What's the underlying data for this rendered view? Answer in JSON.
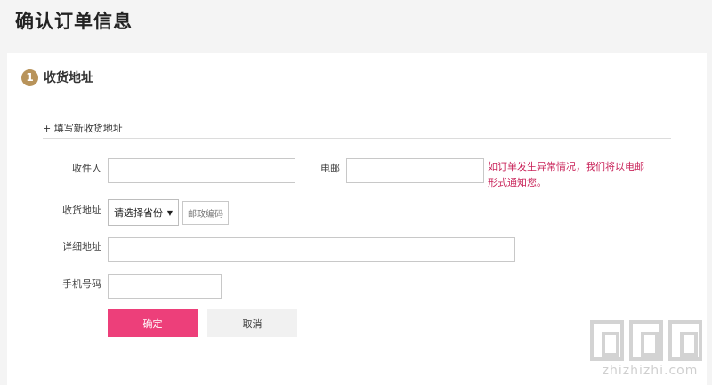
{
  "page": {
    "title": "确认订单信息"
  },
  "section": {
    "step": "1",
    "title": "收货地址"
  },
  "add_address_link": "+ 填写新收货地址",
  "form": {
    "receiver_label": "收件人",
    "receiver_value": "",
    "email_label": "电邮",
    "email_value": "",
    "email_hint": "如订单发生异常情况，我们将以电邮形式通知您。",
    "region_label": "收货地址",
    "province_select": "请选择省份",
    "postcode": "邮政编码",
    "detail_label": "详细地址",
    "detail_value": "",
    "phone_label": "手机号码",
    "phone_value": ""
  },
  "buttons": {
    "confirm": "确定",
    "cancel": "取消"
  },
  "colors": {
    "accent": "#ed3f7a",
    "hint": "#c9245a",
    "step_badge": "#b8935a"
  },
  "watermark": {
    "text": "zhizhizhi.com"
  }
}
